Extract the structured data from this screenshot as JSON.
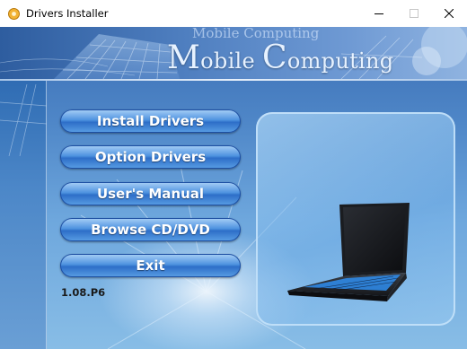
{
  "window": {
    "title": "Drivers Installer",
    "icon": "app-icon"
  },
  "banner": {
    "logo_initial_1": "M",
    "logo_rest_1": "obile",
    "logo_initial_2": "C",
    "logo_rest_2": "omputing",
    "ghost_text": "Mobile Computing"
  },
  "menu": {
    "install_drivers": "Install Drivers",
    "option_drivers": "Option Drivers",
    "users_manual": "User's Manual",
    "browse_cd_dvd": "Browse CD/DVD",
    "exit": "Exit"
  },
  "version": "1.08.P6",
  "colors": {
    "button_top": "#a8d0f6",
    "button_mid": "#2d6ec8",
    "background_top": "#3a6db3",
    "background_bottom": "#88bde6",
    "keyboard_backlight": "#2f8ef0"
  }
}
